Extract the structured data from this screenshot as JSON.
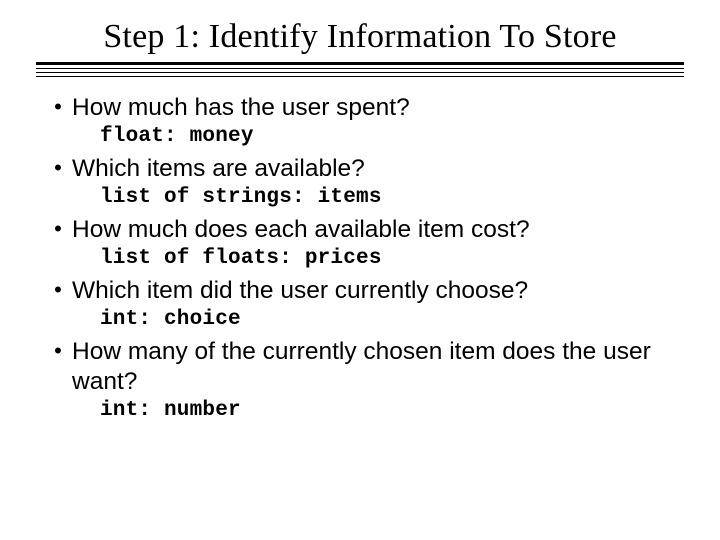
{
  "title": "Step 1: Identify Information To Store",
  "items": [
    {
      "question": "How much has the user spent?",
      "code": "float: money"
    },
    {
      "question": "Which items are available?",
      "code": "list of strings: items"
    },
    {
      "question": "How much does each available item cost?",
      "code": "list of floats: prices"
    },
    {
      "question": "Which item did the user currently choose?",
      "code": "int: choice"
    },
    {
      "question": "How many of the currently chosen item does the user want?",
      "code": "int: number"
    }
  ]
}
